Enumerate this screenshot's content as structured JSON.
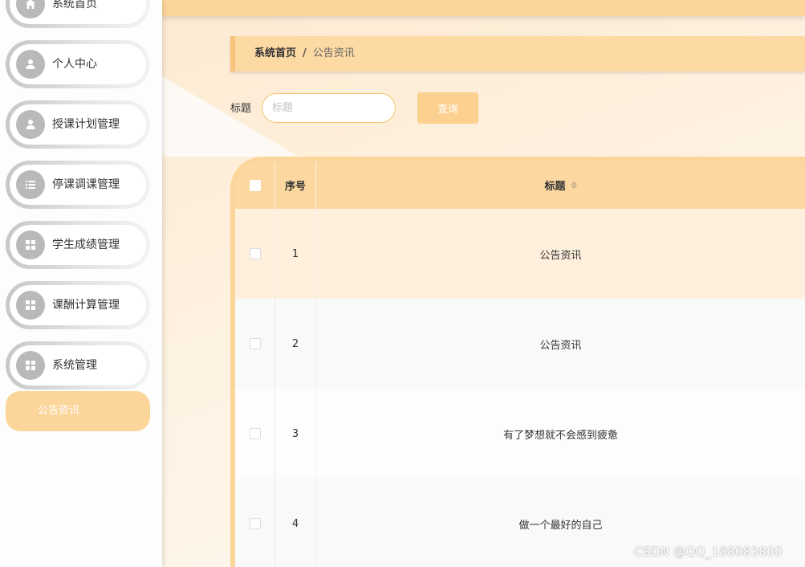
{
  "sidebar": {
    "items": [
      {
        "label": "系统首页",
        "icon": "home-icon"
      },
      {
        "label": "个人中心",
        "icon": "user-icon"
      },
      {
        "label": "授课计划管理",
        "icon": "user-icon"
      },
      {
        "label": "停课调课管理",
        "icon": "list-icon"
      },
      {
        "label": "学生成绩管理",
        "icon": "grid-icon"
      },
      {
        "label": "课酬计算管理",
        "icon": "grid-icon"
      },
      {
        "label": "系统管理",
        "icon": "grid-icon"
      }
    ],
    "active_sub_item": "公告资讯"
  },
  "breadcrumb": {
    "home": "系统首页",
    "separator": "/",
    "current": "公告资讯"
  },
  "search": {
    "label": "标题",
    "placeholder": "标题",
    "button": "查询"
  },
  "table": {
    "columns": {
      "index": "序号",
      "title": "标题"
    },
    "rows": [
      {
        "index": "1",
        "title": "公告资讯"
      },
      {
        "index": "2",
        "title": "公告资讯"
      },
      {
        "index": "3",
        "title": "有了梦想就不会感到疲惫"
      },
      {
        "index": "4",
        "title": "做一个最好的自己"
      }
    ]
  },
  "watermark": "CSDN @QQ_188083800",
  "colors": {
    "accent": "#fcd59a",
    "sidebar_bg": "#fdfdfd",
    "row_highlight": "#fef0dd"
  }
}
